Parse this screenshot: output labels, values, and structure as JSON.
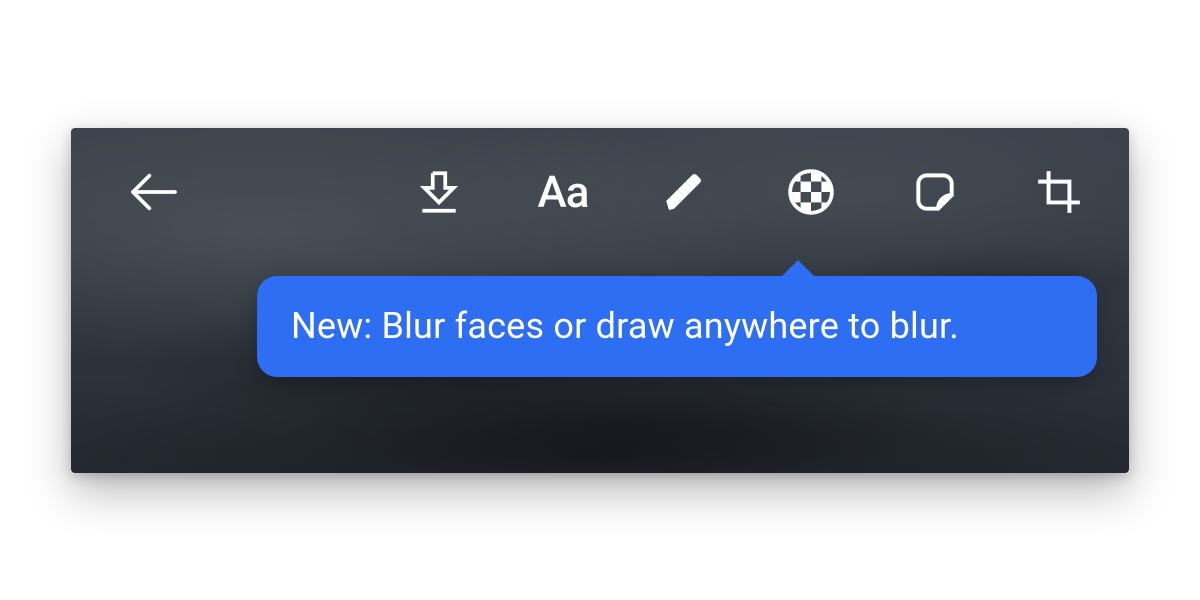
{
  "colors": {
    "tooltip_bg": "#2d6ef2",
    "icon": "#ffffff"
  },
  "toolbar": {
    "back": "back",
    "tools": [
      {
        "name": "download",
        "icon": "download-icon"
      },
      {
        "name": "text",
        "icon": "text-icon"
      },
      {
        "name": "draw",
        "icon": "pen-icon"
      },
      {
        "name": "blur",
        "icon": "blur-icon"
      },
      {
        "name": "sticker",
        "icon": "sticker-icon"
      },
      {
        "name": "crop",
        "icon": "crop-icon"
      }
    ]
  },
  "tooltip": {
    "text": "New: Blur faces or draw anywhere to blur."
  }
}
